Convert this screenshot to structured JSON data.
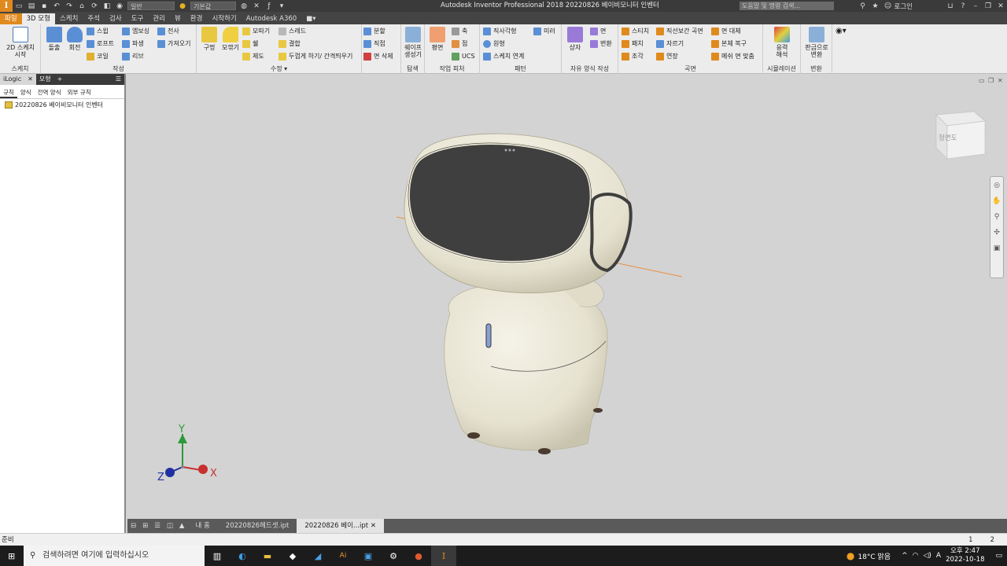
{
  "titlebar": {
    "app_title": "Autodesk Inventor Professional 2018    20220826 베이비모니터 인벤터",
    "search_placeholder": "도움말 및 명령 검색...",
    "login": "로그인",
    "appearance_select": "일반",
    "material_select": "기본값"
  },
  "ribbon_tabs": [
    "3D 모형",
    "스케치",
    "주석",
    "검사",
    "도구",
    "관리",
    "뷰",
    "환경",
    "시작하기",
    "Autodesk A360"
  ],
  "file_tab": "파일",
  "panels": {
    "sketch": {
      "label": "스케치",
      "start_2d": "2D 스케치",
      "start_2d_2": "시작"
    },
    "create": {
      "label": "작성",
      "extrude": "돌출",
      "revolve": "회전",
      "sweep": "스윕",
      "loft": "로프트",
      "coil": "코일",
      "emboss": "엠보싱",
      "derive": "파생",
      "rib": "리브",
      "decal": "전사",
      "import": "가져오기"
    },
    "modify": {
      "label": "수정",
      "hole": "구멍",
      "fillet": "모깎기",
      "chamfer": "모따기",
      "shell": "쉘",
      "draft": "제도",
      "thread": "스레드",
      "combine": "결합",
      "thicken": "두껍게 하기/ 간격띄우기",
      "split": "분할",
      "direct": "직접",
      "delete_face": "면 삭제"
    },
    "explore": {
      "label": "탐색",
      "shape_gen": "쉐이프",
      "shape_gen_2": "생성기"
    },
    "work": {
      "label": "작업 피처",
      "plane": "평면",
      "axis": "축",
      "point": "점",
      "ucs": "UCS"
    },
    "pattern": {
      "label": "패턴",
      "rect": "직사각형",
      "circ": "원형",
      "sketch_driven": "스케치 연계",
      "mirror": "미러"
    },
    "freeform": {
      "label": "자유 양식 작성",
      "box": "상자",
      "face": "면",
      "convert": "변환"
    },
    "surface": {
      "label": "곡면",
      "stitch": "스티치",
      "patch": "패치",
      "sculpt": "조각",
      "ruled": "직선보간 곡면",
      "trim": "자르기",
      "extend": "연장",
      "replace": "면 대체",
      "repair": "본체 복구",
      "fit": "메쉬 면 맞춤"
    },
    "simulation": {
      "label": "시뮬레이션",
      "stress": "응력",
      "stress_2": "해석"
    },
    "convert": {
      "label": "변환",
      "sheet": "판금으로",
      "sheet_2": "변환"
    }
  },
  "browser": {
    "tab_logic": "iLogic",
    "tab_model": "모형",
    "subtabs": [
      "규칙",
      "양식",
      "전역 양식",
      "외부 규칙"
    ],
    "tree_item": "20220826 베이비모니터 인벤터"
  },
  "viewcube_label": "정면도",
  "axes": {
    "x": "X",
    "y": "Y",
    "z": "Z"
  },
  "doctabs": {
    "home": "내 홈",
    "doc1": "20220826헤드셋.ipt",
    "doc2": "20220826 베이...ipt"
  },
  "status": {
    "text": "준비",
    "page1": "1",
    "page2": "2"
  },
  "taskbar": {
    "search": "검색하려면 여기에 입력하십시오",
    "weather": "18°C 맑음",
    "time": "오후 2:47",
    "date": "2022-10-18",
    "lang": "A"
  },
  "colors": {
    "accent": "#e08a1e",
    "titlebar": "#3a3a3a",
    "viewport": "#d3d3d3"
  }
}
